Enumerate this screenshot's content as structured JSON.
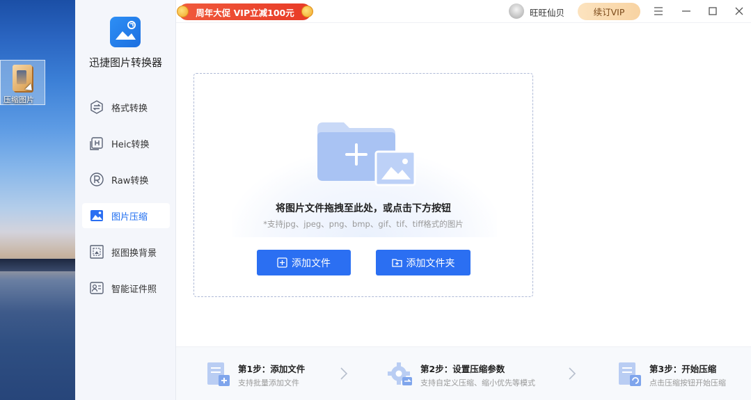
{
  "desktop": {
    "icon_label": "压缩图片"
  },
  "app": {
    "name": "迅捷图片转换器",
    "sidebar": {
      "items": [
        {
          "label": "格式转换",
          "icon": "format-convert-icon",
          "active": false
        },
        {
          "label": "Heic转换",
          "icon": "heic-icon",
          "active": false
        },
        {
          "label": "Raw转换",
          "icon": "raw-icon",
          "active": false
        },
        {
          "label": "图片压缩",
          "icon": "image-compress-icon",
          "active": true
        },
        {
          "label": "抠图换背景",
          "icon": "cutout-icon",
          "active": false
        },
        {
          "label": "智能证件照",
          "icon": "id-photo-icon",
          "active": false
        }
      ]
    },
    "titlebar": {
      "promo": "周年大促 VIP立减100元",
      "user_name": "旺旺仙贝",
      "vip_button": "续订VIP"
    },
    "dropzone": {
      "title": "将图片文件拖拽至此处，或点击下方按钮",
      "subtitle": "*支持jpg、jpeg、png、bmp、gif、tif、tiff格式的图片",
      "add_file": "添加文件",
      "add_folder": "添加文件夹"
    },
    "steps": [
      {
        "title": "第1步：添加文件",
        "desc": "支持批量添加文件"
      },
      {
        "title": "第2步：设置压缩参数",
        "desc": "支持自定义压缩、缩小优先等模式"
      },
      {
        "title": "第3步：开始压缩",
        "desc": "点击压缩按钮开始压缩"
      }
    ],
    "colors": {
      "accent": "#2b6ff2",
      "promo": "#e83a26",
      "vip": "#f8d3a2"
    }
  }
}
